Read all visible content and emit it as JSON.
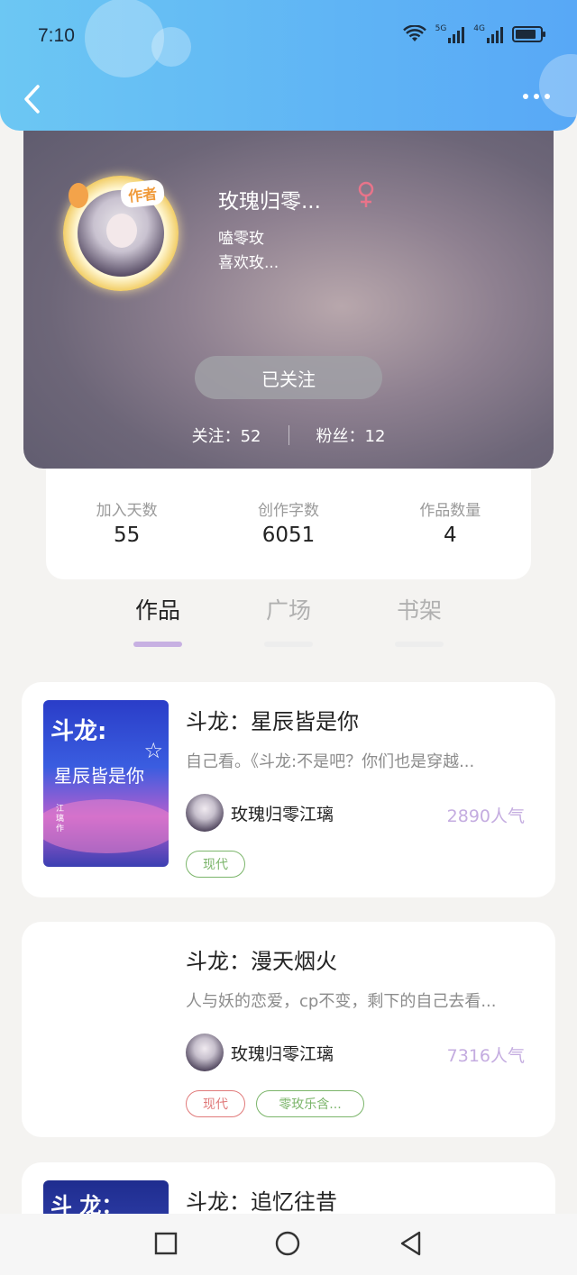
{
  "status_bar": {
    "time": "7:10",
    "net1": "5G",
    "net2": "4G"
  },
  "header": {
    "back_icon": "chevron-left-icon",
    "more_icon": "more-dots-icon"
  },
  "profile": {
    "badge": "作者",
    "name": "玫瑰归零...",
    "gender": "female",
    "line1": "嗑零玫",
    "line2": "喜欢玫...",
    "follow_button": "已关注",
    "following_label": "关注：52",
    "fans_label": "粉丝：12"
  },
  "stats": [
    {
      "label": "加入天数",
      "value": "55"
    },
    {
      "label": "创作字数",
      "value": "6051"
    },
    {
      "label": "作品数量",
      "value": "4"
    }
  ],
  "tabs": [
    {
      "label": "作品",
      "active": true
    },
    {
      "label": "广场",
      "active": false
    },
    {
      "label": "书架",
      "active": false
    }
  ],
  "books": [
    {
      "title": "斗龙：星辰皆是你",
      "desc": "自己看。《斗龙:不是吧？你们也是穿越...",
      "author": "玫瑰归零江璃",
      "popularity": "2890人气",
      "tags": [
        "现代"
      ],
      "cover": {
        "line1": "斗龙:",
        "line2": "星辰皆是你",
        "author": "江璃作"
      }
    },
    {
      "title": "斗龙：漫天烟火",
      "desc": "人与妖的恋爱，cp不变，剩下的自己去看...",
      "author": "玫瑰归零江璃",
      "popularity": "7316人气",
      "tags": [
        "现代",
        "零玫乐含..."
      ]
    },
    {
      "title": "斗龙：追忆往昔",
      "cover": {
        "line1": "斗 龙："
      }
    }
  ],
  "colors": {
    "header_blue": "#5fb4f5",
    "accent_purple": "#c7b0e2",
    "popularity_purple": "#c4ace0",
    "tag_green": "#7bb56a",
    "tag_red": "#e07a7a"
  }
}
